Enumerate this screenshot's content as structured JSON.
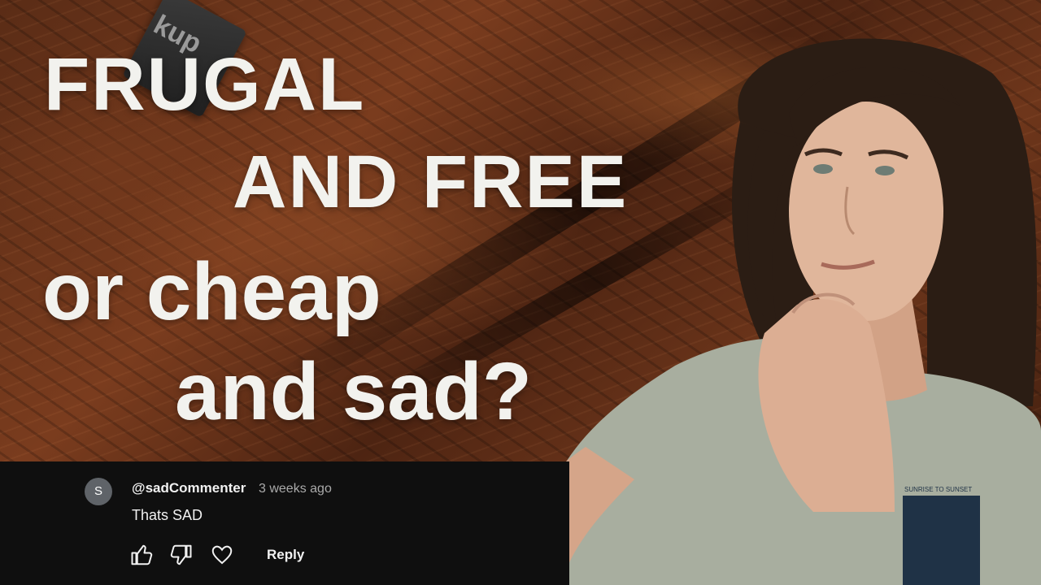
{
  "thumbnail": {
    "headline_line1": "FRUGAL",
    "headline_line2": "AND FREE",
    "headline_line3": "or cheap",
    "headline_line4": "and sad?",
    "logo_tag_text": "kup",
    "accent_text_color": "#f2f2ee",
    "shirt_print_text": "SUNRISE TO SUNSET"
  },
  "comment": {
    "avatar_letter": "S",
    "author": "@sadCommenter",
    "timestamp": "3 weeks ago",
    "text": "Thats SAD",
    "reply_label": "Reply",
    "icons": [
      "thumbs-up-icon",
      "thumbs-down-icon",
      "heart-icon"
    ],
    "panel_color": "#0f0f0f"
  }
}
